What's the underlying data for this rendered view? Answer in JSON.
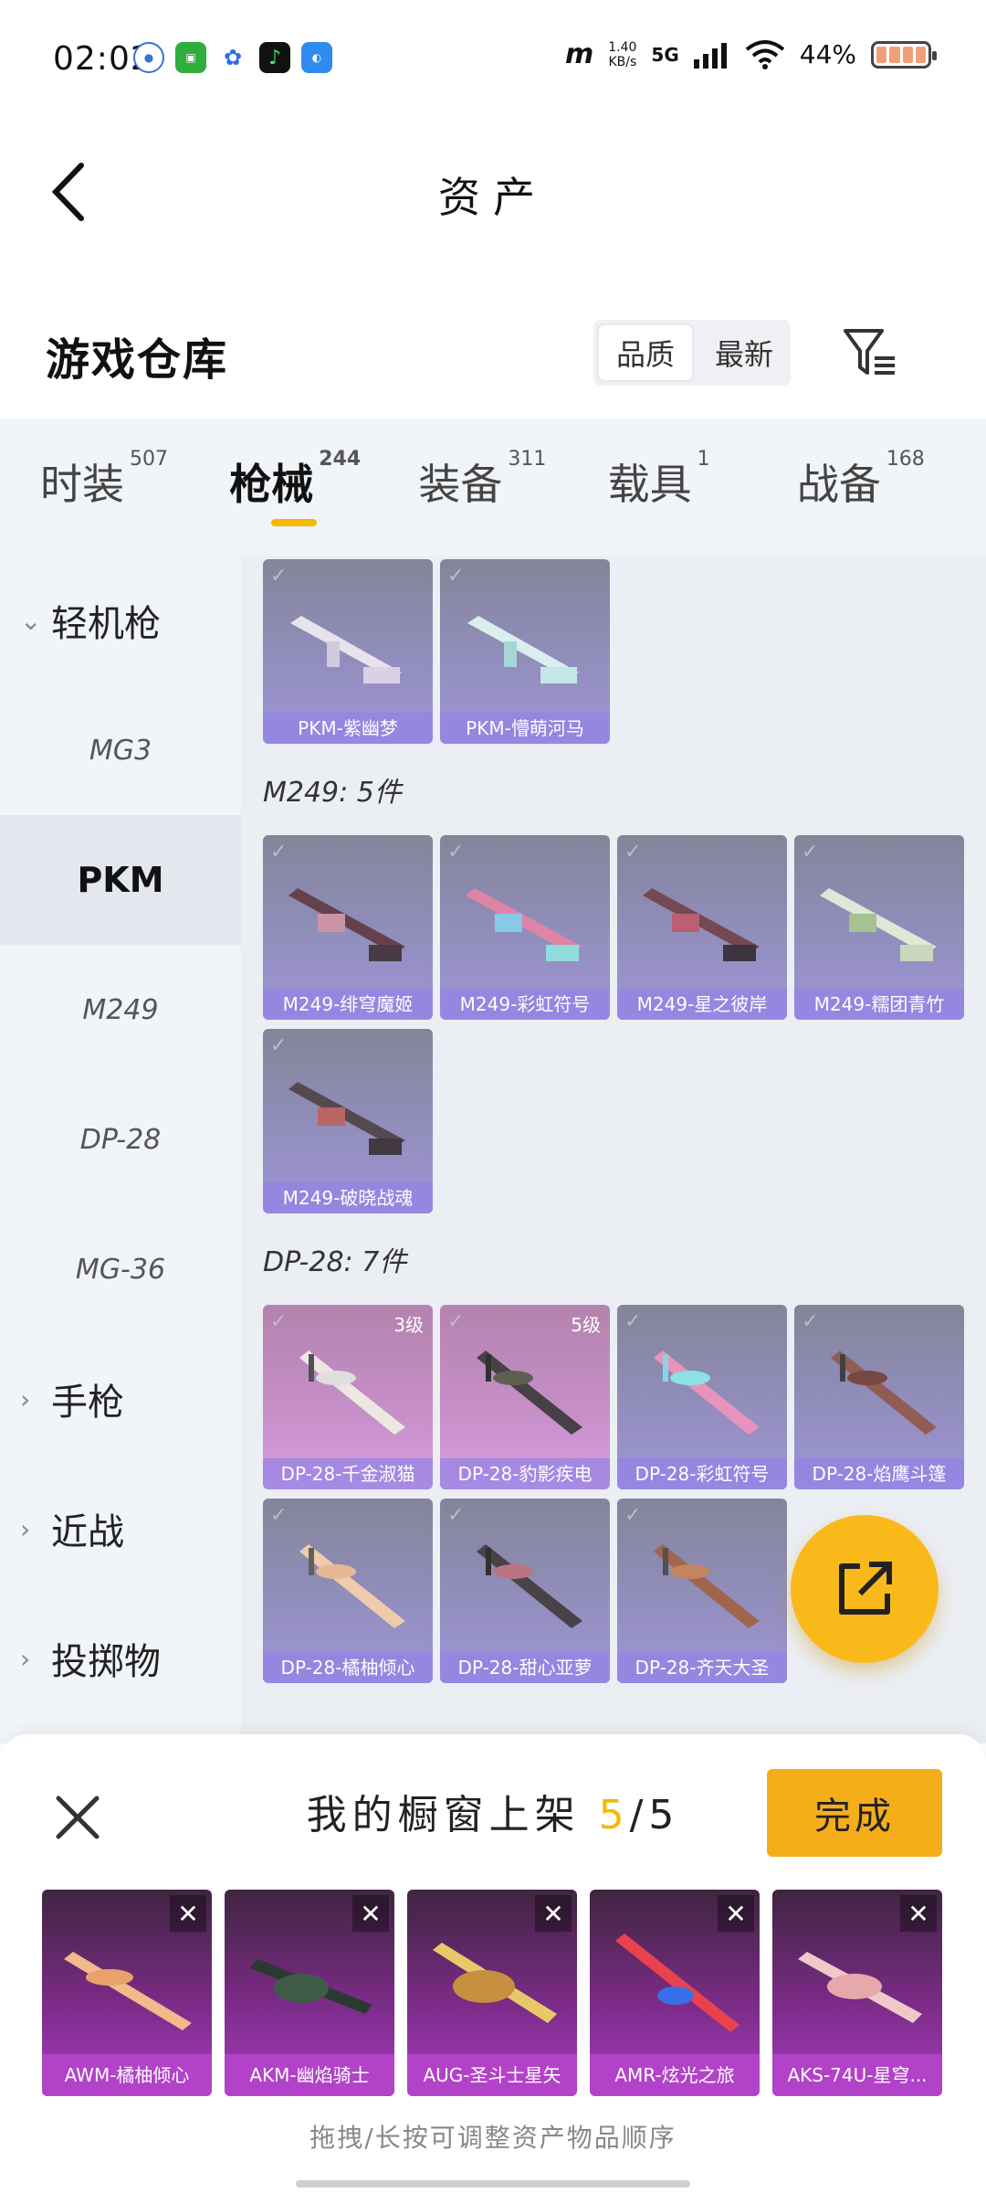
{
  "status": {
    "time": "02:02",
    "speed_value": "1.40",
    "speed_unit": "KB/s",
    "network": "5G",
    "battery": "44%"
  },
  "header": {
    "title": "资产"
  },
  "warehouse": {
    "title": "游戏仓库",
    "sort_options": [
      "品质",
      "最新"
    ]
  },
  "tabs": [
    {
      "label": "时装",
      "count": "507"
    },
    {
      "label": "枪械",
      "count": "244"
    },
    {
      "label": "装备",
      "count": "311"
    },
    {
      "label": "载具",
      "count": "1"
    },
    {
      "label": "战备",
      "count": "168"
    }
  ],
  "sidenav": {
    "groups": [
      "轻机枪",
      "手枪",
      "近战",
      "投掷物"
    ],
    "subs": [
      "MG3",
      "PKM",
      "M249",
      "DP-28",
      "MG-36"
    ]
  },
  "grid": {
    "pkm_items": [
      "PKM-紫幽梦",
      "PKM-懵萌河马"
    ],
    "m249_title": "M249: 5件",
    "m249_items": [
      "M249-绯穹魔姬",
      "M249-彩虹符号",
      "M249-星之彼岸",
      "M249-糯团青竹",
      "M249-破晓战魂"
    ],
    "dp28_title": "DP-28: 7件",
    "dp28_items": [
      "DP-28-千金淑猫",
      "DP-28-豹影疾电",
      "DP-28-彩虹符号",
      "DP-28-焰鹰斗篷",
      "DP-28-橘柚倾心",
      "DP-28-甜心亚萝",
      "DP-28-齐天大圣"
    ],
    "dp28_levels": [
      "3级",
      "5级"
    ]
  },
  "sheet": {
    "title": "我的橱窗上架",
    "count": "5",
    "total": "/5",
    "done": "完成",
    "items": [
      "AWM-橘柚倾心",
      "AKM-幽焰骑士",
      "AUG-圣斗士星矢",
      "AMR-炫光之旅",
      "AKS-74U-星穹..."
    ],
    "hint": "拖拽/长按可调整资产物品顺序"
  }
}
